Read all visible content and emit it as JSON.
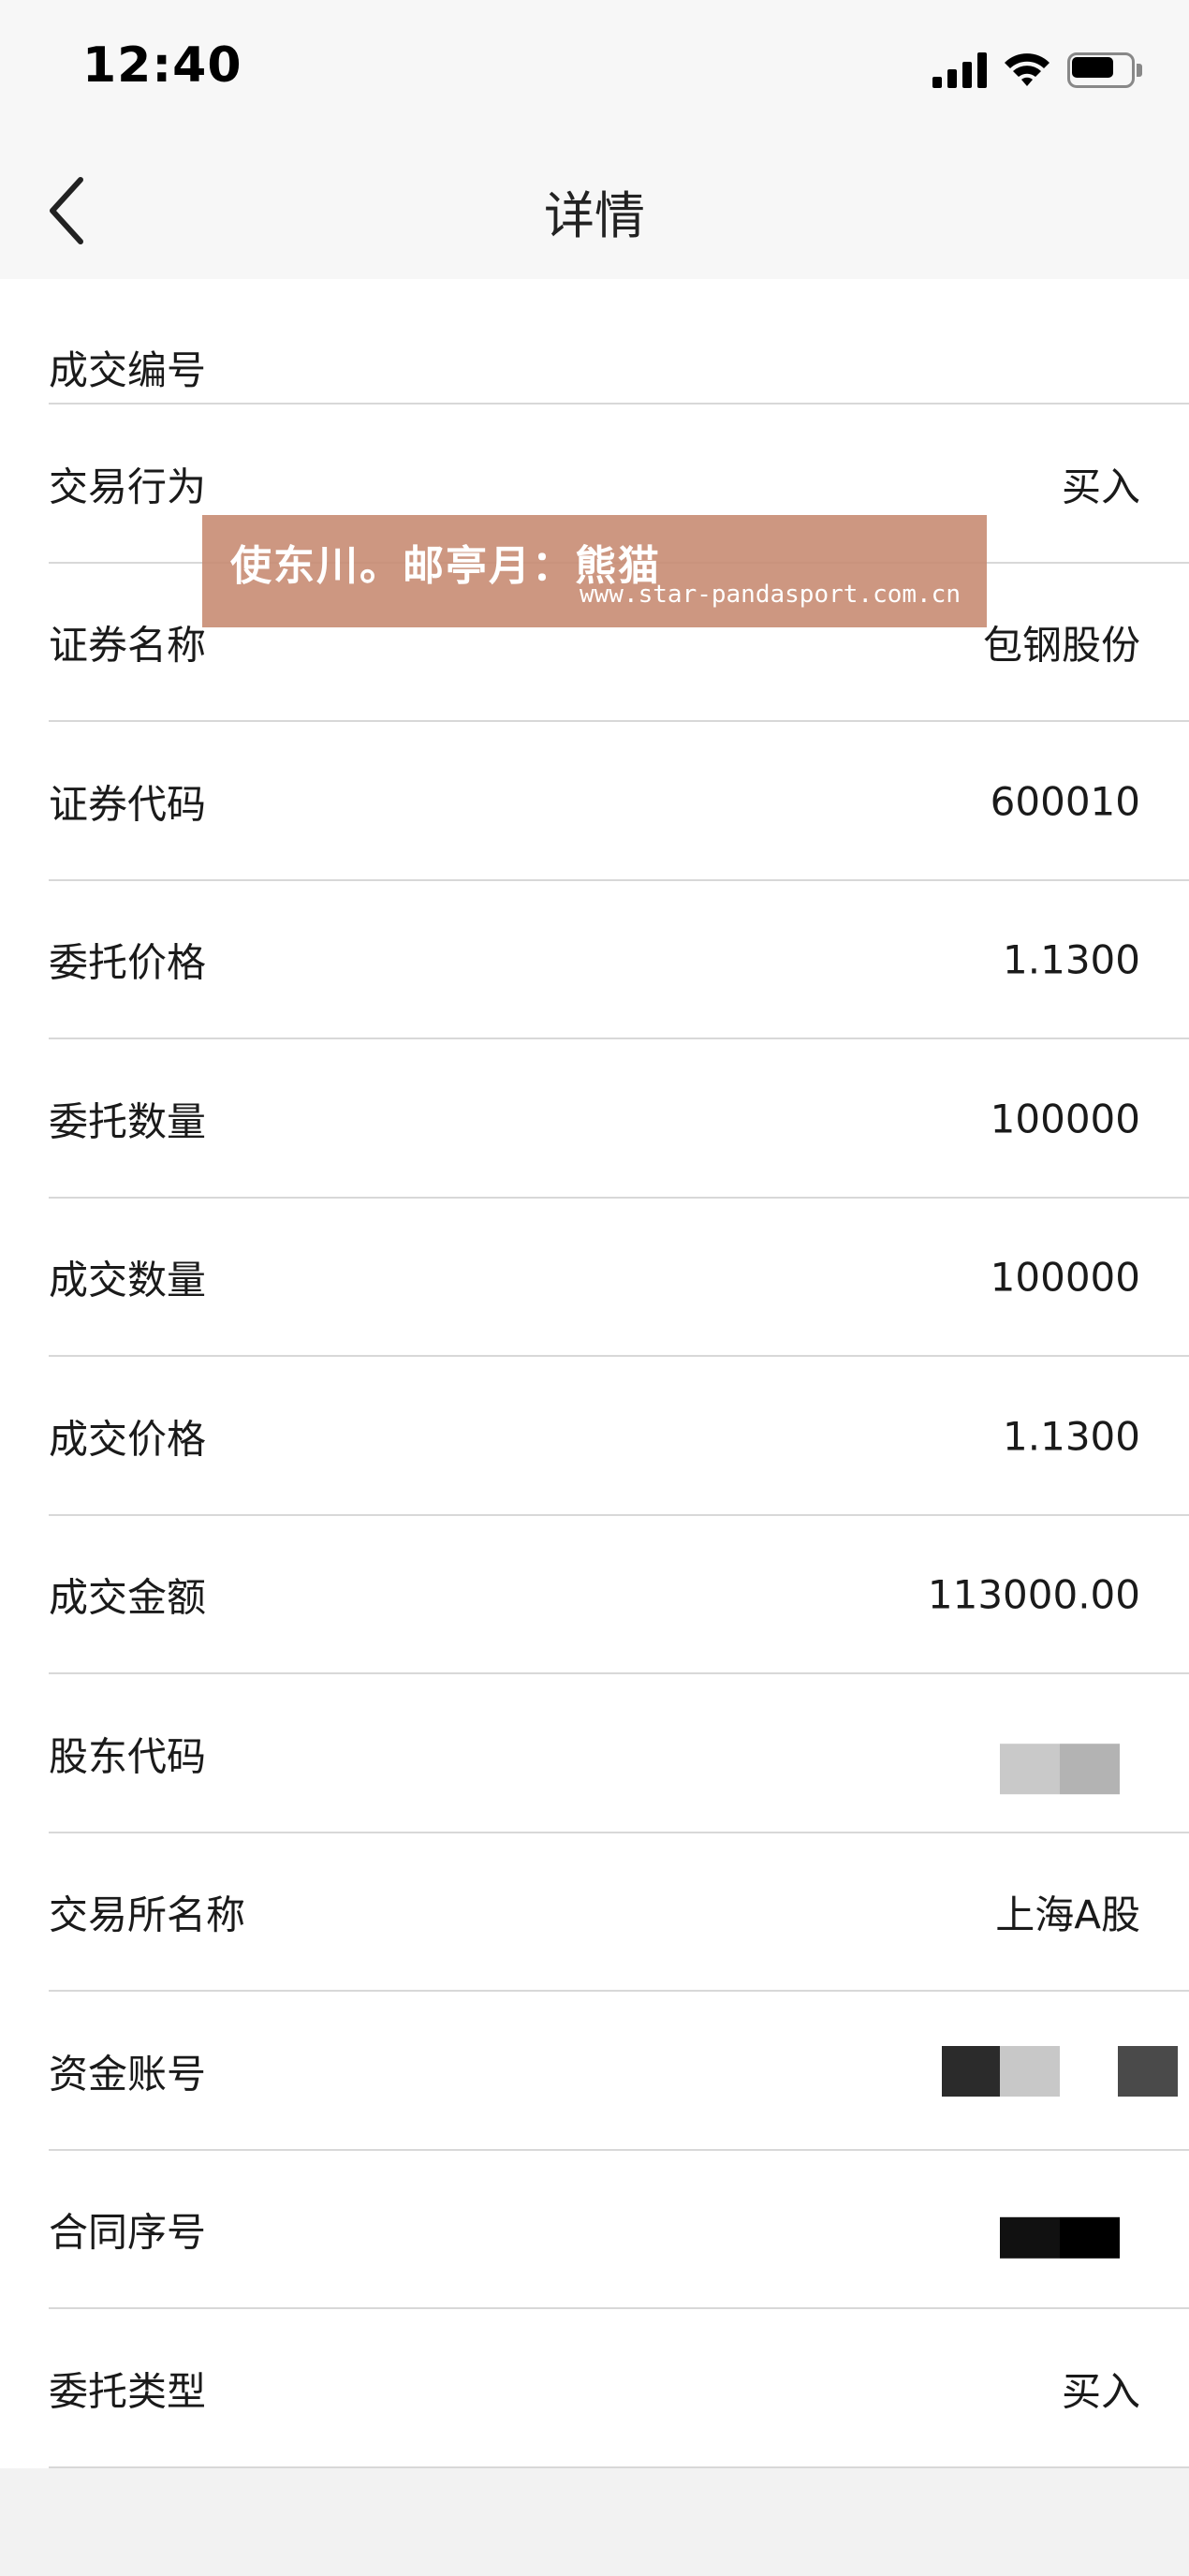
{
  "status_bar": {
    "time": "12:40"
  },
  "nav": {
    "title": "详情",
    "back_icon": "chevron-left-icon"
  },
  "rows": [
    {
      "label": "成交编号",
      "value": ""
    },
    {
      "label": "交易行为",
      "value": "买入"
    },
    {
      "label": "证券名称",
      "value": "包钢股份"
    },
    {
      "label": "证券代码",
      "value": "600010"
    },
    {
      "label": "委托价格",
      "value": "1.1300"
    },
    {
      "label": "委托数量",
      "value": "100000"
    },
    {
      "label": "成交数量",
      "value": "100000"
    },
    {
      "label": "成交价格",
      "value": "1.1300"
    },
    {
      "label": "成交金额",
      "value": "113000.00"
    },
    {
      "label": "股东代码",
      "value": ""
    },
    {
      "label": "交易所名称",
      "value": "上海A股"
    },
    {
      "label": "资金账号",
      "value": ""
    },
    {
      "label": "合同序号",
      "value": ""
    },
    {
      "label": "委托类型",
      "value": "买入"
    }
  ],
  "watermark": {
    "main": "使东川。邮亭月：熊猫",
    "url": "www.star-pandasport.com.cn"
  }
}
